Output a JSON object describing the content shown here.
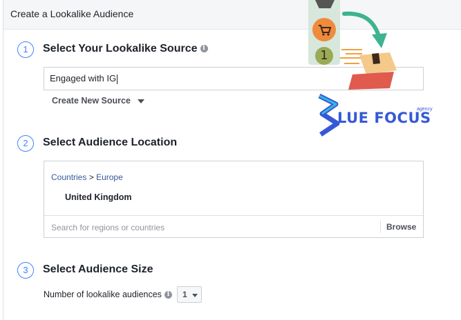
{
  "header": {
    "title": "Create a Lookalike Audience"
  },
  "steps": [
    {
      "number": "1",
      "title": "Select Your Lookalike Source"
    },
    {
      "number": "2",
      "title": "Select Audience Location"
    },
    {
      "number": "3",
      "title": "Select Audience Size"
    }
  ],
  "source": {
    "input_value": "Engaged with IG",
    "create_new_label": "Create New Source"
  },
  "location": {
    "breadcrumb_countries": "Countries",
    "breadcrumb_separator": ">",
    "breadcrumb_region": "Europe",
    "selected_country": "United Kingdom",
    "search_placeholder": "Search for regions or countries",
    "browse_label": "Browse"
  },
  "size": {
    "count_label": "Number of lookalike audiences",
    "count_value": "1"
  },
  "watermark": {
    "logo_text": "LUE FOCUS",
    "agency_text": "agency",
    "badge_number": "1"
  },
  "colors": {
    "accent": "#4080ff",
    "link": "#365899",
    "header_bg": "#f5f6f7",
    "watermark_blue": "#3559d6"
  }
}
